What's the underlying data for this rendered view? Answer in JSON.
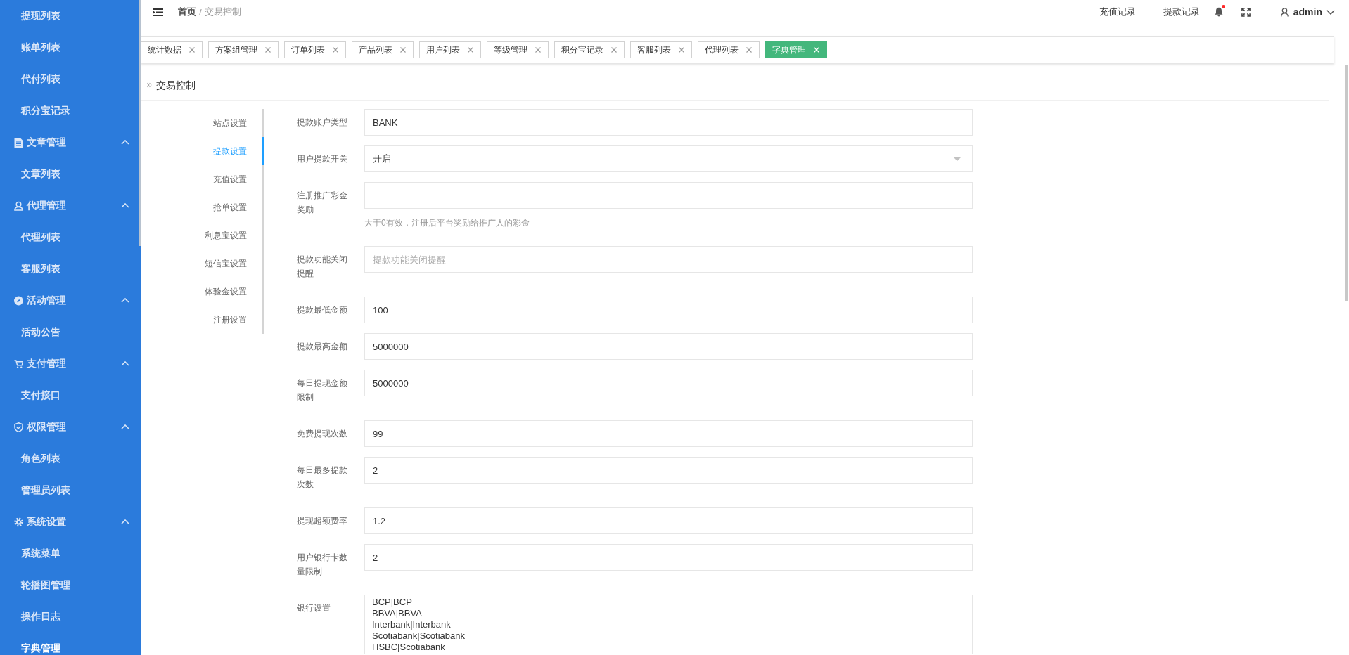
{
  "sidebar": {
    "groups": [
      {
        "expanded": true,
        "children": [
          {
            "label": "提现列表",
            "selected": false
          },
          {
            "label": "账单列表",
            "selected": false
          },
          {
            "label": "代付列表",
            "selected": false
          },
          {
            "label": "积分宝记录",
            "selected": false
          }
        ]
      },
      {
        "label": "文章管理",
        "expanded": true,
        "children": [
          {
            "label": "文章列表",
            "selected": false
          }
        ]
      },
      {
        "label": "代理管理",
        "expanded": true,
        "children": [
          {
            "label": "代理列表",
            "selected": false
          },
          {
            "label": "客服列表",
            "selected": false
          }
        ]
      },
      {
        "label": "活动管理",
        "expanded": true,
        "children": [
          {
            "label": "活动公告",
            "selected": false
          }
        ]
      },
      {
        "label": "支付管理",
        "expanded": true,
        "children": [
          {
            "label": "支付接口",
            "selected": false
          }
        ]
      },
      {
        "label": "权限管理",
        "expanded": true,
        "children": [
          {
            "label": "角色列表",
            "selected": false
          },
          {
            "label": "管理员列表",
            "selected": false
          }
        ]
      },
      {
        "label": "系统设置",
        "expanded": true,
        "children": [
          {
            "label": "系统菜单",
            "selected": false
          },
          {
            "label": "轮播图管理",
            "selected": false
          },
          {
            "label": "操作日志",
            "selected": false
          },
          {
            "label": "字典管理",
            "selected": true
          }
        ]
      }
    ]
  },
  "header": {
    "breadcrumb": {
      "items": [
        "首页",
        "交易控制"
      ],
      "separator": "/"
    },
    "links": [
      "充值记录",
      "提款记录"
    ],
    "notifications": {
      "unread": true
    },
    "user": {
      "name": "admin"
    }
  },
  "tabs": [
    {
      "label": "统计数据",
      "selected": false
    },
    {
      "label": "方案组管理",
      "selected": false
    },
    {
      "label": "订单列表",
      "selected": false
    },
    {
      "label": "产品列表",
      "selected": false
    },
    {
      "label": "用户列表",
      "selected": false
    },
    {
      "label": "等级管理",
      "selected": false
    },
    {
      "label": "积分宝记录",
      "selected": false
    },
    {
      "label": "客服列表",
      "selected": false
    },
    {
      "label": "代理列表",
      "selected": false
    },
    {
      "label": "字典管理",
      "selected": true
    }
  ],
  "page": {
    "title": "交易控制",
    "settings_menu": [
      {
        "label": "站点设置",
        "selected": false
      },
      {
        "label": "提款设置",
        "selected": true
      },
      {
        "label": "充值设置",
        "selected": false
      },
      {
        "label": "抢单设置",
        "selected": false
      },
      {
        "label": "利息宝设置",
        "selected": false
      },
      {
        "label": "短信宝设置",
        "selected": false
      },
      {
        "label": "体验金设置",
        "selected": false
      },
      {
        "label": "注册设置",
        "selected": false
      }
    ],
    "form": {
      "fields": [
        {
          "kind": "text",
          "label": "提款账户类型",
          "value": "BANK"
        },
        {
          "kind": "select",
          "label": "用户提款开关",
          "value": "开启"
        },
        {
          "kind": "text",
          "label": "注册推广彩金奖励",
          "help": "大于0有效，注册后平台奖励给推广人的彩金"
        },
        {
          "kind": "text",
          "label": "提款功能关闭提醒",
          "placeholder": "提款功能关闭提醒"
        },
        {
          "kind": "text",
          "label": "提款最低金额",
          "value": "100"
        },
        {
          "kind": "text",
          "label": "提款最高金额",
          "value": "5000000"
        },
        {
          "kind": "text",
          "label": "每日提现金额限制",
          "value": "5000000"
        },
        {
          "kind": "text",
          "label": "免费提现次数",
          "value": "99"
        },
        {
          "kind": "text",
          "label": "每日最多提款次数",
          "value": "2"
        },
        {
          "kind": "text",
          "label": "提现超额费率",
          "value": "1.2"
        },
        {
          "kind": "text",
          "label": "用户银行卡数量限制",
          "value": "2"
        },
        {
          "kind": "textarea",
          "label": "银行设置",
          "value": "BCP|BCP\nBBVA|BBVA\nInterbank|Interbank\nScotiabank|Scotiabank\nHSBC|Scotiabank"
        }
      ]
    }
  }
}
